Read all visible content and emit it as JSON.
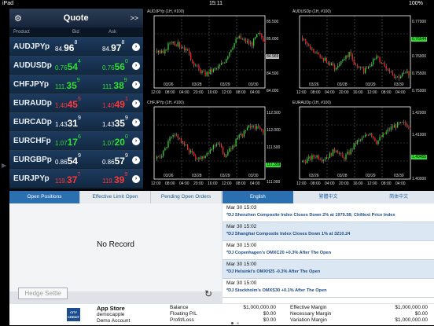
{
  "status": {
    "device": "iPad",
    "time": "15:11",
    "battery": "100%"
  },
  "quote": {
    "title": "Quote",
    "more": ">>",
    "col_product": "Product",
    "col_bid": "Bid",
    "col_ask": "Ask",
    "rows": [
      {
        "sym": "AUDJPYp",
        "bid": [
          "84.",
          "96",
          "8"
        ],
        "ask": [
          "84.",
          "97",
          "8"
        ],
        "dir": "wh"
      },
      {
        "sym": "AUDUSDp",
        "bid": [
          "0.76",
          "54",
          "4"
        ],
        "ask": [
          "0.76",
          "56",
          "0"
        ],
        "dir": "up"
      },
      {
        "sym": "CHFJPYp",
        "bid": [
          "111.",
          "35",
          "9"
        ],
        "ask": [
          "111.",
          "38",
          "9"
        ],
        "dir": "up"
      },
      {
        "sym": "EURAUDp",
        "bid": [
          "1.40",
          "45",
          "5"
        ],
        "ask": [
          "1.40",
          "49",
          "1"
        ],
        "dir": "dn"
      },
      {
        "sym": "EURCADp",
        "bid": [
          "1.43",
          "31",
          "9"
        ],
        "ask": [
          "1.43",
          "35",
          "9"
        ],
        "dir": "wh"
      },
      {
        "sym": "EURCHFp",
        "bid": [
          "1.07",
          "17",
          "6"
        ],
        "ask": [
          "1.07",
          "20",
          "0"
        ],
        "dir": "up"
      },
      {
        "sym": "EURGBPp",
        "bid": [
          "0.86",
          "54",
          "9"
        ],
        "ask": [
          "0.86",
          "57",
          "9"
        ],
        "dir": "wh"
      },
      {
        "sym": "EURJPYp",
        "bid": [
          "119.",
          "37",
          "7"
        ],
        "ask": [
          "119.",
          "39",
          "9"
        ],
        "dir": "dn"
      }
    ]
  },
  "charts": [
    {
      "label": "AUDJPYp (1H, #100)",
      "ticks": [
        "85.500",
        "85.000",
        "84.969",
        "84.500",
        "84.000"
      ],
      "dates": [
        "03/26",
        "03/28",
        "03/29",
        "03/30"
      ],
      "times": [
        "12:00",
        "08:00",
        "04:00",
        "20:00",
        "16:00",
        "12:00",
        "08:00",
        "04:00"
      ],
      "last_color": "#bbbbbb"
    },
    {
      "label": "AUDUSDp (1H, #100)",
      "ticks": [
        "0.77000",
        "0.76544",
        "0.76000",
        "0.75500",
        "0.75000"
      ],
      "dates": [
        "03/26",
        "03/28",
        "03/29",
        "03/30"
      ],
      "times": [
        "12:00",
        "08:00",
        "04:00",
        "20:00",
        "16:00",
        "12:00",
        "08:00",
        "04:00"
      ],
      "last_color": "#2fe02f"
    },
    {
      "label": "CHFJPYp (1H, #100)",
      "ticks": [
        "112.500",
        "112.000",
        "111.500",
        "111.359",
        "111.000"
      ],
      "dates": [
        "03/26",
        "03/28",
        "03/29",
        "03/30"
      ],
      "times": [
        "12:00",
        "08:00",
        "04:00",
        "20:00",
        "16:00",
        "12:00",
        "08:00",
        "04:00"
      ],
      "last_color": "#2fe02f"
    },
    {
      "label": "EURAUDp (1H, #100)",
      "ticks": [
        "1.42000",
        "1.41000",
        "1.40455",
        "1.40000"
      ],
      "dates": [
        "03/26",
        "03/28",
        "03/29",
        "03/30"
      ],
      "times": [
        "12:00",
        "08:00",
        "04:00",
        "20:00",
        "16:00",
        "12:00",
        "08:00",
        "04:00"
      ],
      "last_color": "#2fe02f"
    }
  ],
  "positions": {
    "tabs": [
      "Open Positions",
      "Effective Limit Open",
      "Pending Open Orders"
    ],
    "empty": "No Record",
    "hedge": "Hedge Settle"
  },
  "news": {
    "tabs": [
      "English",
      "繁體中文",
      "简体中文"
    ],
    "items": [
      {
        "date": "Mar 30 15:03",
        "head": "*DJ Shenzhen Composite Index Closes Down 2% at 1979.58; ChiNext Price Index"
      },
      {
        "date": "Mar 30 15:02",
        "head": "*DJ Shanghai Composite Index Closes Down 1% at 3210.24"
      },
      {
        "date": "Mar 30 15:00",
        "head": "*DJ Copenhagen's OMXC20 +0.3% After The Open"
      },
      {
        "date": "Mar 30 15:00",
        "head": "*DJ Helsinki's OMXH25 -0.3% After The Open"
      },
      {
        "date": "Mar 30 15:00",
        "head": "*DJ Stockholm's OMXS30 +0.1% After The Open"
      }
    ]
  },
  "account": {
    "logo": "CITY CREDIT",
    "name": "App Store",
    "user": "democapple",
    "type": "Demo Account",
    "balance_l": "Balance",
    "balance": "$1,000,000.00",
    "floating_l": "Floating P/L",
    "floating": "$0.00",
    "profit_l": "Profit/Loss",
    "profit": "$0.00",
    "eff_l": "Effective Margin",
    "eff": "$1,000,000.00",
    "nec_l": "Necessary Margin",
    "nec": "$0.00",
    "var_l": "Variation Margin",
    "var": "$1,000,000.00"
  }
}
